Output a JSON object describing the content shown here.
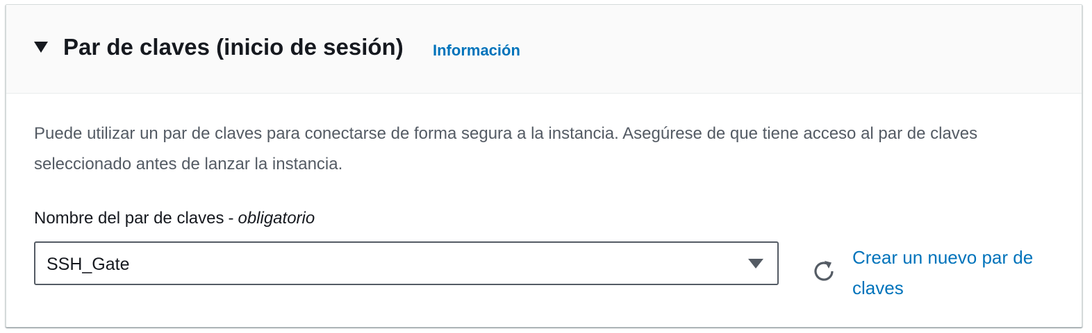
{
  "section": {
    "title": "Par de claves (inicio de sesión)",
    "info_link": "Información",
    "expanded_icon": "caret-down-icon",
    "description": "Puede utilizar un par de claves para conectarse de forma segura a la instancia. Asegúrese de que tiene acceso al par de claves seleccionado antes de lanzar la instancia."
  },
  "key_pair_field": {
    "label": "Nombre del par de claves",
    "separator": "-",
    "required_text": "obligatorio",
    "selected_value": "SSH_Gate"
  },
  "actions": {
    "refresh_icon": "refresh-icon",
    "create_link": "Crear un nuevo par de claves"
  },
  "colors": {
    "link": "#0073bb",
    "text_primary": "#16191f",
    "text_secondary": "#545b64",
    "header_bg": "#fafafa"
  }
}
